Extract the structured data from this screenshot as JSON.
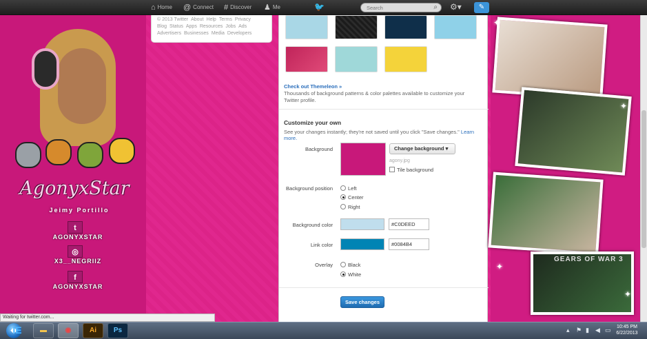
{
  "topbar": {
    "nav": [
      {
        "label": "Home",
        "icon": "home-icon"
      },
      {
        "label": "Connect",
        "icon": "at-icon"
      },
      {
        "label": "Discover",
        "icon": "hash-icon"
      },
      {
        "label": "Me",
        "icon": "person-icon"
      }
    ],
    "search_placeholder": "Search"
  },
  "profile": {
    "brand_title": "AgonyxStar",
    "brand_subtitle": "Jeimy Portillo",
    "links": [
      {
        "label": "AGONYXSTAR",
        "icon": "twitter-icon"
      },
      {
        "label": "X3__NEGRIIZ",
        "icon": "instagram-icon"
      },
      {
        "label": "AGONYXSTAR",
        "icon": "facebook-icon"
      }
    ]
  },
  "footer": {
    "links": [
      "© 2013 Twitter",
      "About",
      "Help",
      "Terms",
      "Privacy",
      "Blog",
      "Status",
      "Apps",
      "Resources",
      "Jobs",
      "Ads",
      "Advertisers",
      "Businesses",
      "Media",
      "Developers"
    ]
  },
  "design": {
    "themeleon_link": "Check out Themeleon »",
    "themeleon_desc": "Thousands of background patterns & color palettes available to customize your Twitter profile.",
    "customize_title": "Customize your own",
    "customize_desc": "See your changes instantly; they're not saved until you click \"Save changes.\"",
    "learn_more": "Learn more.",
    "background_label": "Background",
    "change_background": "Change background",
    "filename": "agony.jpg",
    "tile_background": "Tile background",
    "position_label": "Background position",
    "position_options": [
      "Left",
      "Center",
      "Right"
    ],
    "position_selected": "Center",
    "bg_color_label": "Background color",
    "bg_color_value": "#C0DEED",
    "link_color_label": "Link color",
    "link_color_value": "#0084B4",
    "overlay_label": "Overlay",
    "overlay_options": [
      "Black",
      "White"
    ],
    "overlay_selected": "White",
    "save_button": "Save changes"
  },
  "status_bar": "Waiting for twitter.com...",
  "photos_caption": "GEARS OF WAR 3",
  "taskbar": {
    "apps": [
      "IE",
      "Explorer",
      "Chrome",
      "Ai",
      "Ps"
    ],
    "time": "10:45 PM",
    "date": "6/22/2013"
  },
  "colors": {
    "background_pink": "#d9137e",
    "link_blue": "#2a6ebb",
    "bg_color": "#C0DEED",
    "link_color": "#0084B4"
  }
}
